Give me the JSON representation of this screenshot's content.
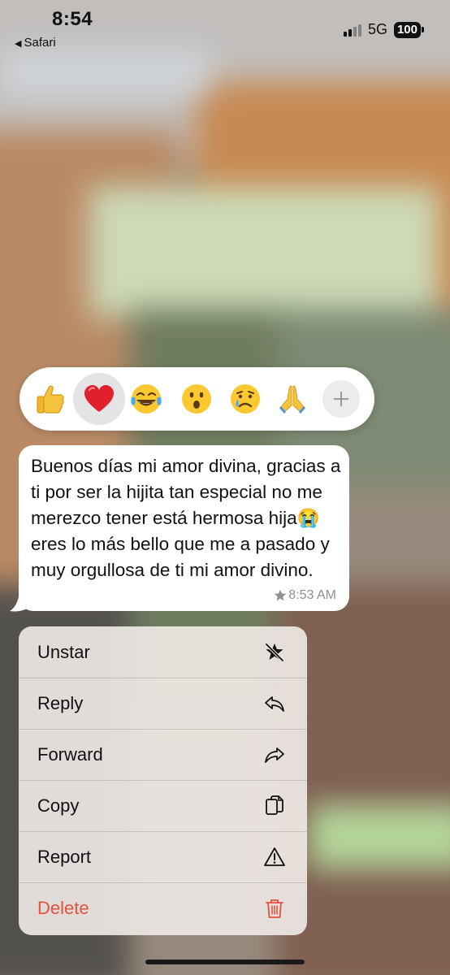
{
  "status_bar": {
    "time": "8:54",
    "back_app": "Safari",
    "network": "5G",
    "battery": "100"
  },
  "reactions": [
    {
      "name": "thumbs-up",
      "selected": false
    },
    {
      "name": "red-heart",
      "selected": true
    },
    {
      "name": "tears-of-joy",
      "selected": false
    },
    {
      "name": "surprised-face",
      "selected": false
    },
    {
      "name": "crying-face",
      "selected": false
    },
    {
      "name": "folded-hands",
      "selected": false
    },
    {
      "name": "add-reaction",
      "selected": false
    }
  ],
  "message": {
    "text": "Buenos días mi amor divina, gracias a ti por ser la hijita tan especial no me merezco tener está hermosa hija😭eres lo más bello que me a pasado y muy orgullosa de ti mi amor divino.",
    "time": "8:53 AM",
    "starred": true
  },
  "menu": {
    "items": [
      {
        "label": "Unstar",
        "icon": "unstar-icon"
      },
      {
        "label": "Reply",
        "icon": "reply-icon"
      },
      {
        "label": "Forward",
        "icon": "forward-icon"
      },
      {
        "label": "Copy",
        "icon": "copy-icon"
      },
      {
        "label": "Report",
        "icon": "warning-icon"
      },
      {
        "label": "Delete",
        "icon": "trash-icon",
        "destructive": true
      }
    ]
  },
  "colors": {
    "destructive": "#e5503f",
    "bubble": "#ffffff",
    "meta_text": "#8e8e93"
  }
}
